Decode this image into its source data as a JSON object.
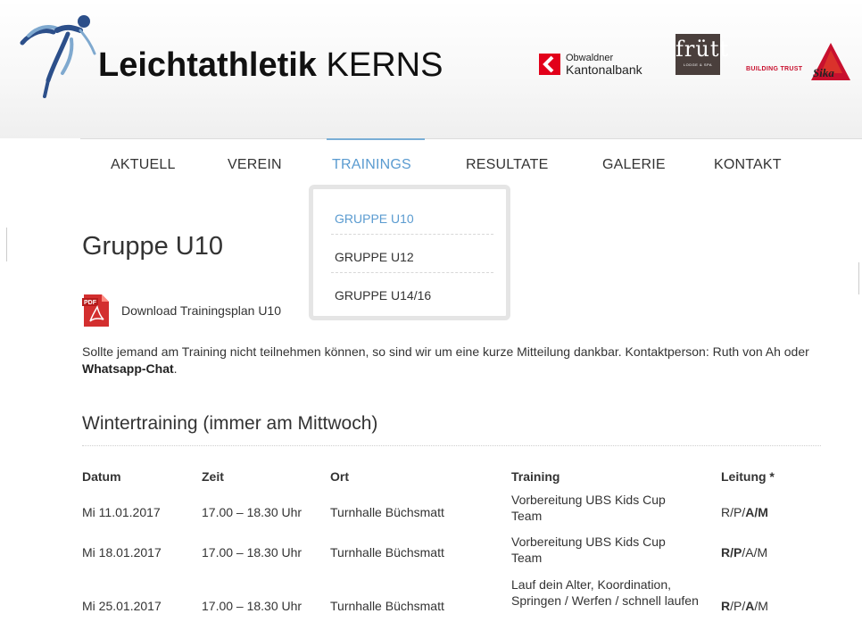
{
  "header": {
    "logo_bold": "Leichtathletik",
    "logo_light": "KERNS",
    "sponsors": {
      "okb_line1": "Obwaldner",
      "okb_line2": "Kantonalbank",
      "frutt_word": "frütt",
      "frutt_sub": "LODGE & SPA",
      "sika_tagline": "BUILDING TRUST",
      "sika_word": "Sika"
    }
  },
  "nav": {
    "items": [
      "AKTUELL",
      "VEREIN",
      "TRAININGS",
      "RESULTATE",
      "GALERIE",
      "KONTAKT"
    ],
    "active": "TRAININGS"
  },
  "dropdown": {
    "items": [
      "GRUPPE U10",
      "GRUPPE U12",
      "GRUPPE U14/16"
    ],
    "active": "GRUPPE U10"
  },
  "content": {
    "title": "Gruppe U10",
    "download_label": "Download Trainingsplan U10",
    "intro_text": "Sollte jemand am Training nicht teilnehmen können, so sind wir um eine kurze Mitteilung dankbar. Kontaktperson: Ruth von Ah oder ",
    "intro_link": "Whatsapp-Chat",
    "intro_end": ".",
    "section_title": "Wintertraining (immer am Mittwoch)"
  },
  "table": {
    "headers": [
      "Datum",
      "Zeit",
      "Ort",
      "Training",
      "Leitung *"
    ],
    "rows": [
      {
        "datum": "Mi 11.01.2017",
        "zeit": "17.00 – 18.30 Uhr",
        "ort": "Turnhalle Büchsmatt",
        "training": "Vorbereitung UBS Kids Cup Team",
        "leitung_plain": "R/P/",
        "leitung_bold": "A/M",
        "leitung_rest": ""
      },
      {
        "datum": "Mi 18.01.2017",
        "zeit": "17.00 – 18.30 Uhr",
        "ort": "Turnhalle Büchsmatt",
        "training": "Vorbereitung UBS Kids Cup Team",
        "leitung_bold_first": "R/P",
        "leitung_plain_after": "/A/M"
      },
      {
        "datum": "Mi 25.01.2017",
        "zeit": "17.00 – 18.30 Uhr",
        "ort": "Turnhalle Büchsmatt",
        "training": "Lauf dein Alter, Koordination, Springen / Werfen / schnell laufen",
        "leitung_b1": "R",
        "leitung_p1": "/P/",
        "leitung_b2": "A",
        "leitung_p2": "/M"
      }
    ]
  },
  "colors": {
    "accent": "#5a9bd0",
    "okb_red": "#e2001a",
    "sika_red": "#c8102e",
    "frutt_brown": "#4a3f3c"
  }
}
